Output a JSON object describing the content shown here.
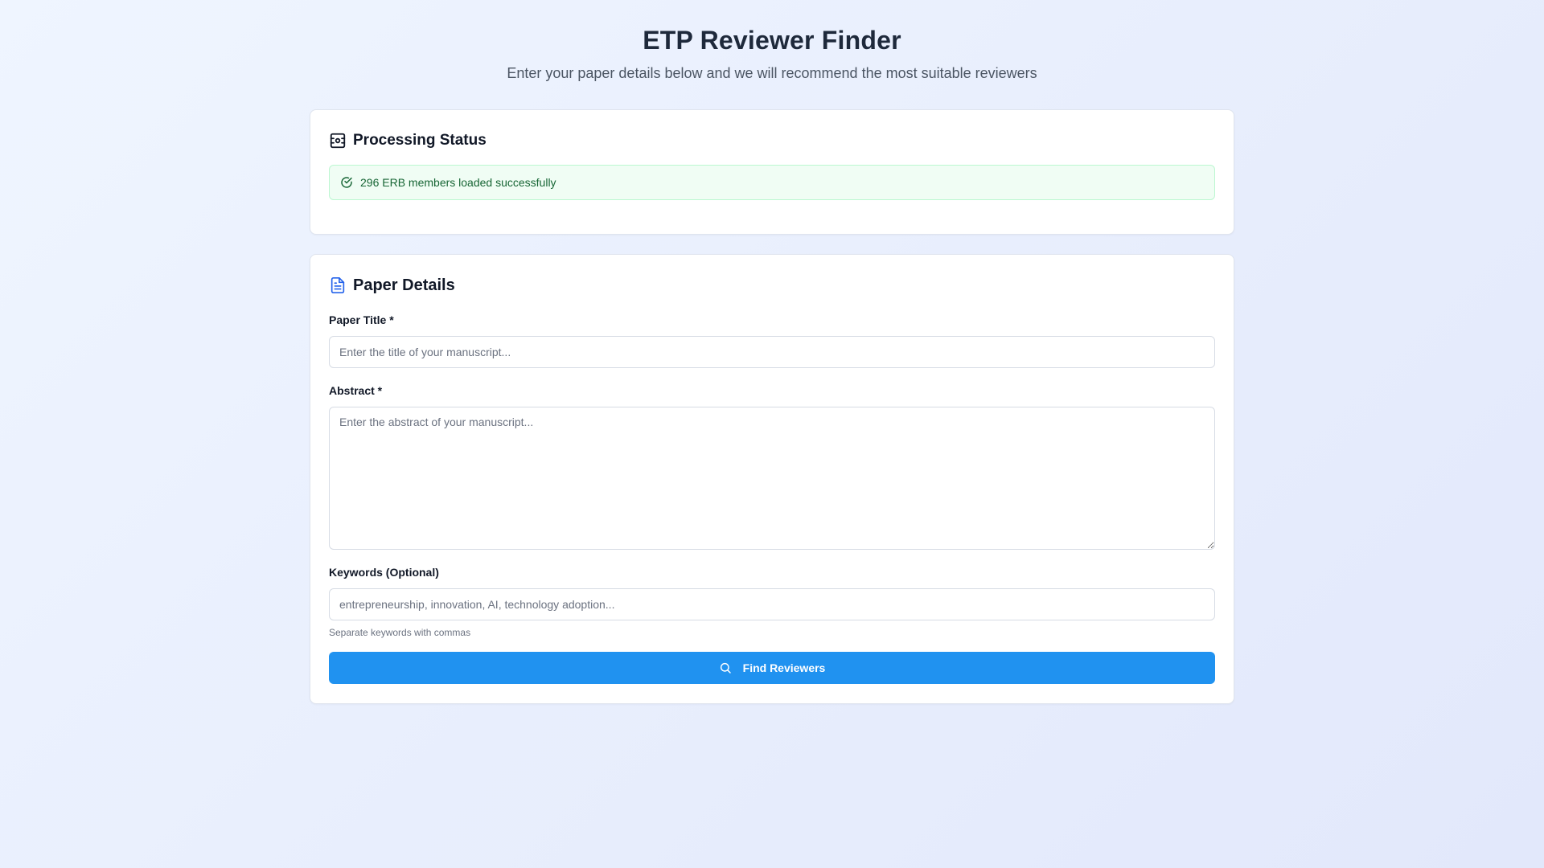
{
  "header": {
    "title": "ETP Reviewer Finder",
    "subtitle": "Enter your paper details below and we will recommend the most suitable reviewers"
  },
  "status": {
    "title": "Processing Status",
    "icon": "scanner-icon",
    "message": "296 ERB members loaded successfully",
    "message_icon": "check-circle-icon",
    "colors": {
      "success_bg": "#f0fdf4",
      "success_border": "#bbf7d0",
      "success_text": "#166534"
    }
  },
  "paper": {
    "title": "Paper Details",
    "icon": "document-icon",
    "title_field": {
      "label": "Paper Title *",
      "value": "",
      "placeholder": "Enter the title of your manuscript..."
    },
    "abstract_field": {
      "label": "Abstract *",
      "value": "",
      "placeholder": "Enter the abstract of your manuscript..."
    },
    "keywords_field": {
      "label": "Keywords (Optional)",
      "value": "",
      "placeholder": "entrepreneurship, innovation, AI, technology adoption...",
      "helper": "Separate keywords with commas"
    },
    "submit": {
      "label": "Find Reviewers",
      "icon": "search-icon",
      "color": "#2092f0"
    }
  }
}
